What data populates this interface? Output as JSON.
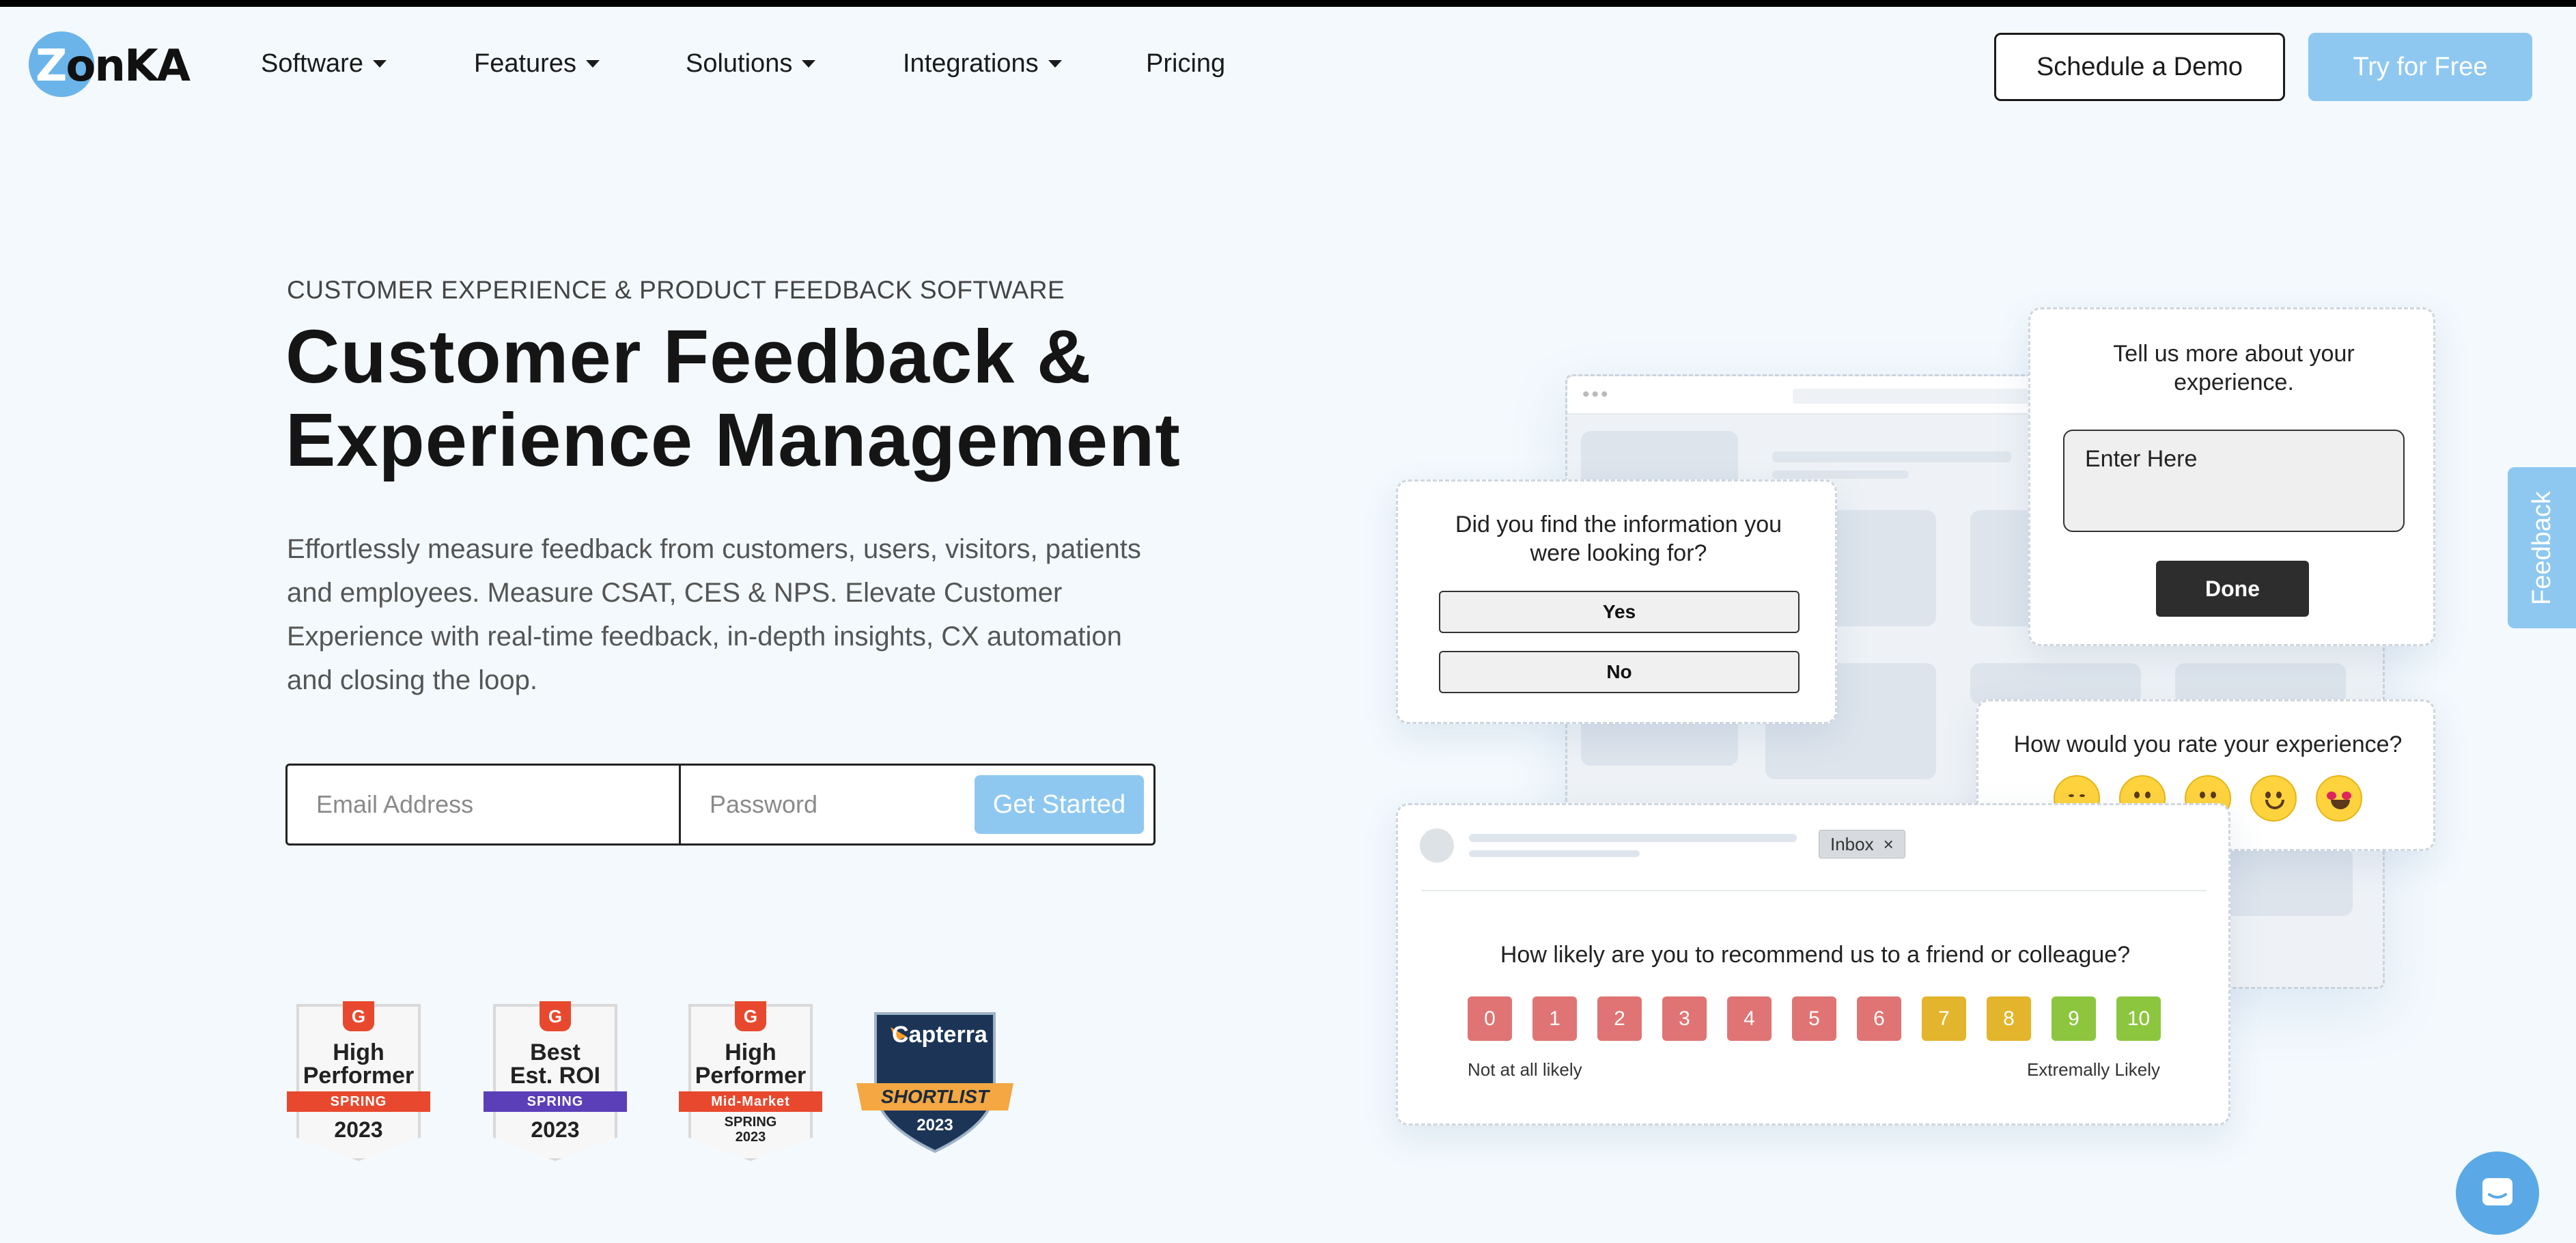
{
  "brand": {
    "logo_text_z": "Z",
    "logo_text_rest": "onKA",
    "accent": "#8ec8f0",
    "logo_circle": "#6ab4ea"
  },
  "nav": {
    "items": [
      {
        "label": "Software",
        "dropdown": true
      },
      {
        "label": "Features",
        "dropdown": true
      },
      {
        "label": "Solutions",
        "dropdown": true
      },
      {
        "label": "Integrations",
        "dropdown": true
      },
      {
        "label": "Pricing",
        "dropdown": false
      }
    ],
    "demo_label": "Schedule a Demo",
    "try_label": "Try for Free"
  },
  "hero": {
    "eyebrow": "CUSTOMER EXPERIENCE & PRODUCT FEEDBACK SOFTWARE",
    "title_line1": "Customer Feedback &",
    "title_line2": "Experience Management",
    "description": "Effortlessly measure feedback from customers, users, visitors, patients and employees. Measure CSAT, CES & NPS. Elevate Customer Experience with real-time feedback, in-depth insights, CX automation and closing the loop."
  },
  "signup": {
    "email_placeholder": "Email Address",
    "password_placeholder": "Password",
    "button_label": "Get Started"
  },
  "badges": [
    {
      "logo": "G",
      "line1": "High",
      "line2": "Performer",
      "ribbon": "SPRING",
      "ribbon_color": "#e8492e",
      "year": "2023"
    },
    {
      "logo": "G",
      "line1": "Best",
      "line2": "Est. ROI",
      "ribbon": "SPRING",
      "ribbon_color": "#5a3fb8",
      "year": "2023"
    },
    {
      "logo": "G",
      "line1": "High",
      "line2": "Performer",
      "ribbon": "Mid-Market",
      "ribbon_color": "#e8492e",
      "year_line1": "SPRING",
      "year_line2": "2023"
    },
    {
      "brand": "Capterra",
      "ribbon": "SHORTLIST",
      "year": "2023"
    }
  ],
  "widgets": {
    "info_question": "Did you find the information you were looking for?",
    "yes_label": "Yes",
    "no_label": "No",
    "tell_more": "Tell us more about your experience.",
    "enter_here": "Enter Here",
    "done_label": "Done",
    "rate_question": "How would you rate your experience?",
    "inbox_label": "Inbox",
    "inbox_close": "×",
    "nps_question": "How likely are you to recommend us to a friend or colleague?",
    "nps_scale": [
      "0",
      "1",
      "2",
      "3",
      "4",
      "5",
      "6",
      "7",
      "8",
      "9",
      "10"
    ],
    "nps_colors": [
      "#e07474",
      "#e07474",
      "#e07474",
      "#e07474",
      "#e07474",
      "#e07474",
      "#e07474",
      "#e3b52c",
      "#e3b52c",
      "#8cc63f",
      "#8cc63f"
    ],
    "nps_low": "Not at all likely",
    "nps_high": "Extremally Likely"
  },
  "side": {
    "feedback_label": "Feedback"
  }
}
